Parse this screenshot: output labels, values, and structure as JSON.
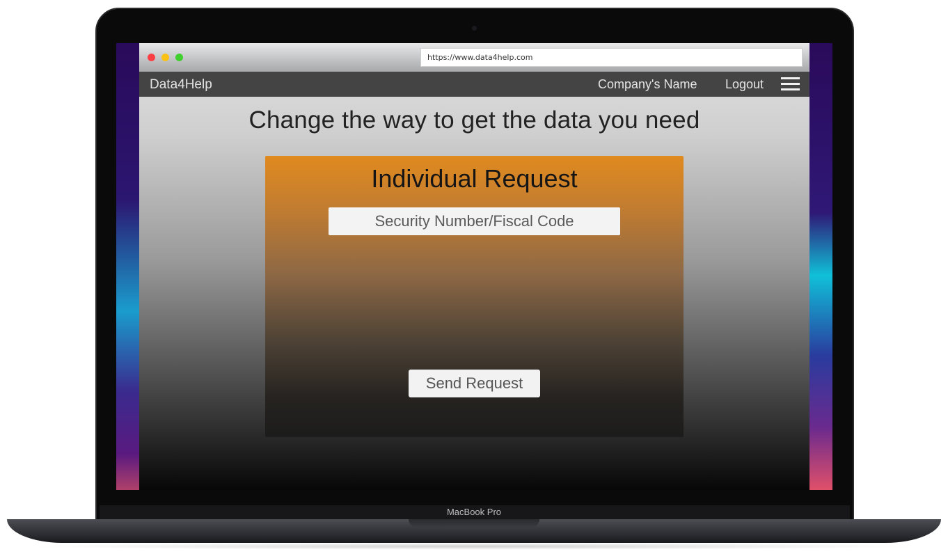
{
  "browser": {
    "url": "https://www.data4help.com"
  },
  "navbar": {
    "brand": "Data4Help",
    "company_name": "Company's Name",
    "logout_label": "Logout",
    "menu_icon": "hamburger-menu-icon"
  },
  "main": {
    "headline": "Change the way to get the data you need",
    "card": {
      "title": "Individual Request",
      "fiscal_input": {
        "value": "",
        "placeholder": "Security Number/Fiscal Code"
      },
      "send_label": "Send Request"
    }
  },
  "device": {
    "model_label": "MacBook Pro"
  },
  "colors": {
    "navbar_bg": "#444444",
    "card_top": "#e08a1f",
    "close_dot": "#fc3e45",
    "minimize_dot": "#fbc215",
    "zoom_dot": "#3fd02e"
  }
}
